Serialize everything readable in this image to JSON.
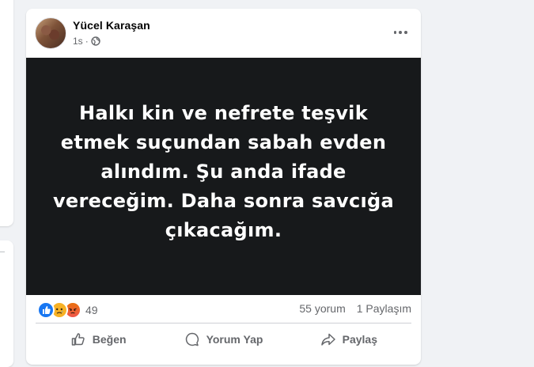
{
  "post": {
    "author": "Yücel Karaşan",
    "time": "1s",
    "separator": "·",
    "image_text": "Halkı kin ve nefrete teşvik etmek suçundan sabah evden alındım. Şu anda ifade vereceğim. Daha sonra savcığa çıkacağım.",
    "reactions_count": "49",
    "comments": "55 yorum",
    "shares": "1 Paylaşım"
  },
  "actions": {
    "like": "Beğen",
    "comment": "Yorum Yap",
    "share": "Paylaş"
  },
  "icons": [
    "globe-icon",
    "more-icon",
    "like-reaction-icon",
    "sad-reaction-icon",
    "angry-reaction-icon",
    "thumbs-up-icon",
    "comment-icon",
    "share-icon"
  ]
}
